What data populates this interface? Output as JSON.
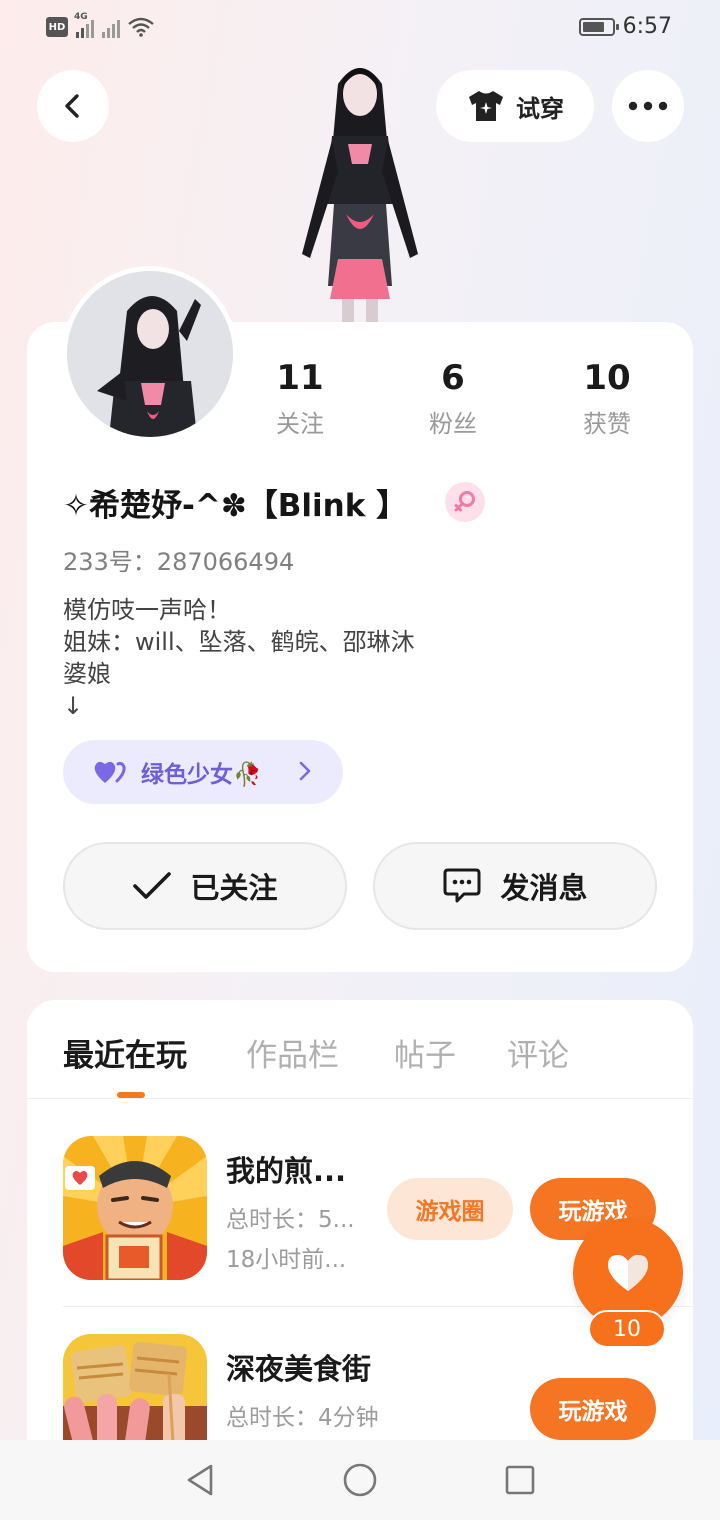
{
  "status_bar": {
    "hd": "HD",
    "network": "4G",
    "time": "6:57"
  },
  "header": {
    "back_icon": "chevron-left-icon",
    "tryon_label": "试穿",
    "more_icon": "more-dots-icon"
  },
  "profile": {
    "stats": [
      {
        "value": "11",
        "label": "关注"
      },
      {
        "value": "6",
        "label": "粉丝"
      },
      {
        "value": "10",
        "label": "获赞"
      }
    ],
    "username": "✧希楚妤-^✽【Blink 】",
    "gender_icon": "female-icon",
    "uid": "233号：287066494",
    "bio": [
      "模仿吱一声哈！",
      "姐妹：will、坠落、鹤皖、邵琳沐",
      "婆娘",
      "↓"
    ],
    "tag_label": "绿色少女🥀",
    "follow_label": "已关注",
    "message_label": "发消息"
  },
  "tabs": [
    "最近在玩",
    "作品栏",
    "帖子",
    "评论"
  ],
  "active_tab": 0,
  "games": [
    {
      "title": "我的煎...",
      "duration": "总时长：5...",
      "last_played": "18小时前...",
      "circle_label": "游戏圈",
      "play_label": "玩游戏"
    },
    {
      "title": "深夜美食街",
      "duration": "总时长：4分钟",
      "play_label": "玩游戏"
    }
  ],
  "like_fab": {
    "count": "10"
  },
  "colors": {
    "accent": "#f57522",
    "tag_bg": "#ecebfd",
    "tag_text": "#6f5fd6"
  }
}
